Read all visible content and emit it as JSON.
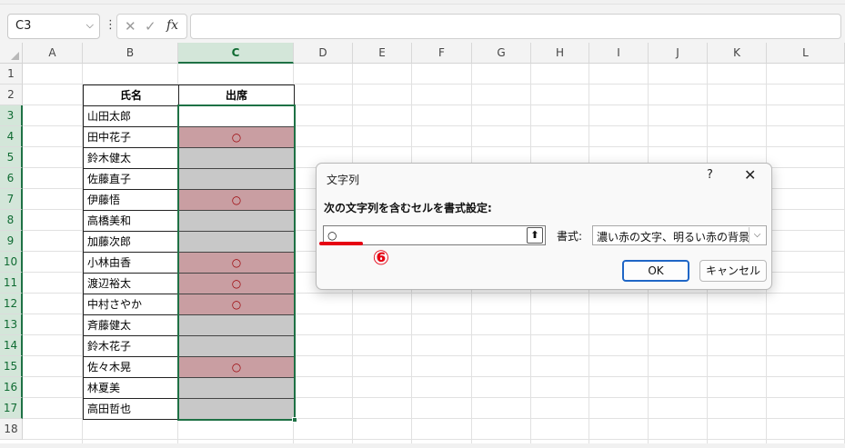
{
  "formula_bar": {
    "name_box": "C3",
    "name_box_chevron": "⌵",
    "more_icon": "⋮",
    "cancel_icon": "✕",
    "enter_icon": "✓",
    "fx_label": "fx",
    "formula": ""
  },
  "columns": [
    "A",
    "B",
    "C",
    "D",
    "E",
    "F",
    "G",
    "H",
    "I",
    "J",
    "K",
    "L"
  ],
  "rows": [
    "1",
    "2",
    "3",
    "4",
    "5",
    "6",
    "7",
    "8",
    "9",
    "10",
    "11",
    "12",
    "13",
    "14",
    "15",
    "16",
    "17",
    "18"
  ],
  "table": {
    "header_name": "氏名",
    "header_attendance": "出席",
    "names": [
      "山田太郎",
      "田中花子",
      "鈴木健太",
      "佐藤直子",
      "伊藤悟",
      "高橋美和",
      "加藤次郎",
      "小林由香",
      "渡辺裕太",
      "中村さやか",
      "斉藤健太",
      "鈴木花子",
      "佐々木晃",
      "林夏美",
      "高田哲也"
    ],
    "attendance": [
      "",
      "○",
      "",
      "",
      "○",
      "",
      "",
      "○",
      "○",
      "○",
      "",
      "",
      "○",
      "",
      ""
    ],
    "cell_fill": [
      "white",
      "red",
      "gray",
      "gray",
      "red",
      "gray",
      "gray",
      "red",
      "red",
      "red",
      "gray",
      "gray",
      "red",
      "gray",
      "gray"
    ]
  },
  "colors": {
    "accent_green": "#1e7145",
    "highlight_red": "#c99ea2",
    "highlight_gray": "#c8c8c8",
    "annotation_red": "#e60012",
    "ok_border": "#1f66c6"
  },
  "dialog": {
    "title": "文字列",
    "help": "?",
    "close": "✕",
    "prompt": "次の文字列を含むセルを書式設定:",
    "input_value": "○",
    "collapse_icon": "⬆",
    "format_label": "書式:",
    "format_value": "濃い赤の文字、明るい赤の背景",
    "dropdown_icon": "⌵",
    "ok": "OK",
    "cancel": "キャンセル"
  },
  "annotation": {
    "step": "⑥"
  }
}
